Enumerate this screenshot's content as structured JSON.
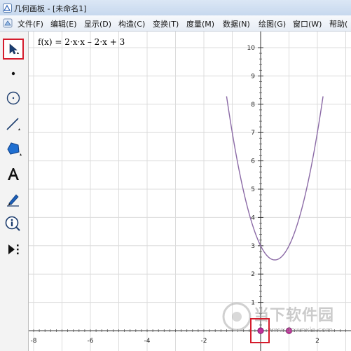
{
  "window": {
    "title": "几何画板 - [未命名1]"
  },
  "menu": {
    "items": [
      {
        "label": "文件(F)"
      },
      {
        "label": "编辑(E)"
      },
      {
        "label": "显示(D)"
      },
      {
        "label": "构造(C)"
      },
      {
        "label": "变换(T)"
      },
      {
        "label": "度量(M)"
      },
      {
        "label": "数据(N)"
      },
      {
        "label": "绘图(G)"
      },
      {
        "label": "窗口(W)"
      },
      {
        "label": "帮助("
      }
    ]
  },
  "toolbox": {
    "tools": [
      {
        "name": "arrow-select-tool",
        "selected": true
      },
      {
        "name": "point-tool",
        "selected": false
      },
      {
        "name": "compass-tool",
        "selected": false
      },
      {
        "name": "straightedge-tool",
        "selected": false
      },
      {
        "name": "polygon-tool",
        "selected": false
      },
      {
        "name": "text-tool",
        "selected": false
      },
      {
        "name": "marker-tool",
        "selected": false
      },
      {
        "name": "information-tool",
        "selected": false
      },
      {
        "name": "custom-tool",
        "selected": false
      }
    ]
  },
  "graph": {
    "function_label": "f(x) = 2·x·x – 2·x + 3",
    "x_tick_labels": [
      "-8",
      "-6",
      "-4",
      "-2",
      "2"
    ],
    "y_tick_labels": [
      "1",
      "2",
      "3",
      "4",
      "5",
      "6",
      "7",
      "8",
      "9",
      "10"
    ],
    "curve_color": "#8b6aa6",
    "point_color": "#c0309a",
    "highlight_color": "#d51c2c"
  },
  "watermark": {
    "text": "当下软件园",
    "url": "www.downxia.com"
  }
}
